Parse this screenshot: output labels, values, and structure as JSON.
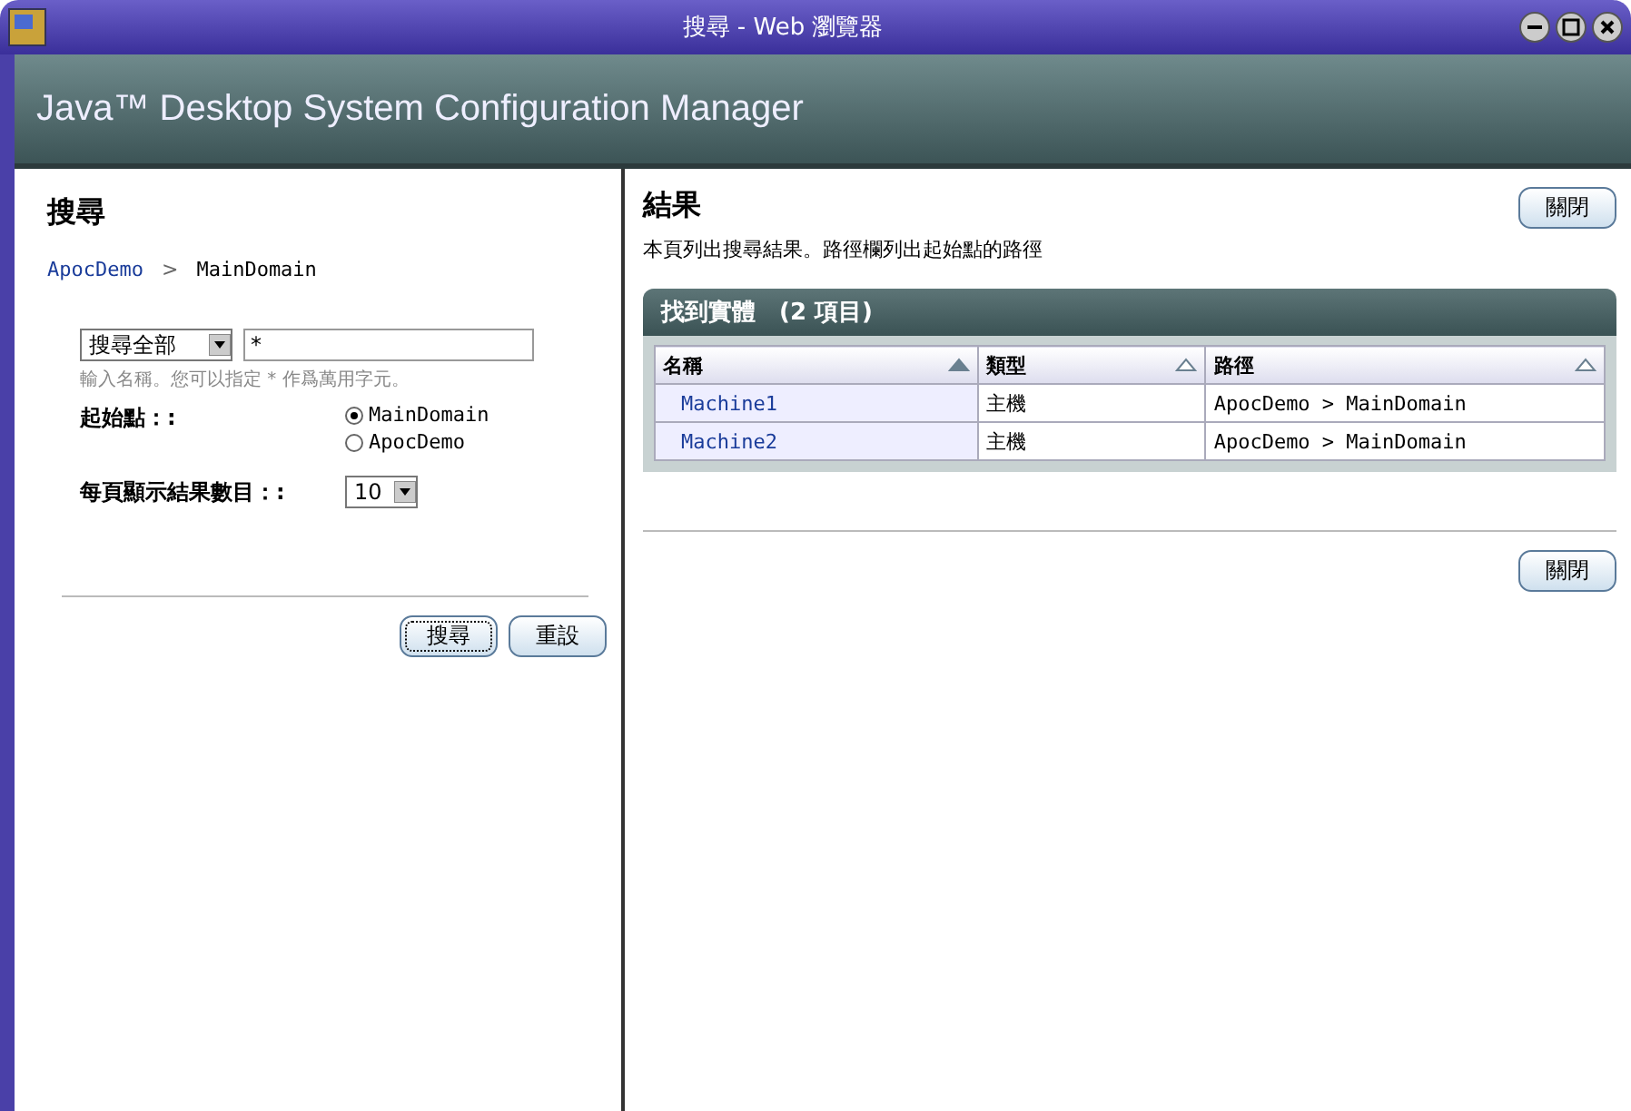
{
  "window": {
    "title": "搜尋 - Web 瀏覽器"
  },
  "banner": {
    "title": "Java™ Desktop System Configuration Manager"
  },
  "search_panel": {
    "heading": "搜尋",
    "breadcrumb_separator": ">",
    "breadcrumb": [
      {
        "label": "ApocDemo",
        "link": true
      },
      {
        "label": "MainDomain",
        "link": false
      }
    ],
    "scope_select": {
      "value": "搜尋全部"
    },
    "query_field": {
      "value": "*"
    },
    "hint": "輸入名稱。您可以指定 * 作爲萬用字元。",
    "start_label": "起始點：:",
    "start_options": [
      {
        "label": "MainDomain",
        "selected": true
      },
      {
        "label": "ApocDemo",
        "selected": false
      }
    ],
    "per_page_label": "每頁顯示結果數目：:",
    "per_page_select": {
      "value": "10"
    },
    "buttons": [
      {
        "label": "搜尋",
        "focused": true
      },
      {
        "label": "重設",
        "focused": false
      }
    ]
  },
  "results_panel": {
    "heading": "結果",
    "description": "本頁列出搜尋結果。路徑欄列出起始點的路徑",
    "top_button": "關閉",
    "table": {
      "title": "找到實體　(2 項目)",
      "columns": [
        {
          "label": "名稱",
          "sorted": true
        },
        {
          "label": "類型",
          "sorted": false
        },
        {
          "label": "路徑",
          "sorted": false
        }
      ],
      "rows": [
        [
          "Machine1",
          "主機",
          "ApocDemo > MainDomain"
        ],
        [
          "Machine2",
          "主機",
          "ApocDemo > MainDomain"
        ]
      ]
    },
    "bottom_button": "關閉"
  }
}
